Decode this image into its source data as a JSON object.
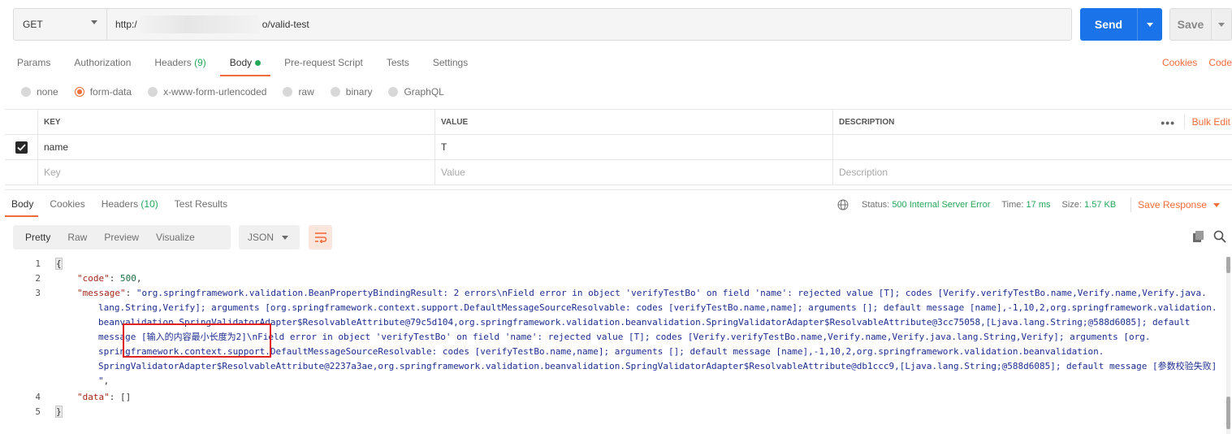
{
  "request": {
    "method": "GET",
    "url_prefix": "http:/",
    "url_suffix": "o/valid-test",
    "send_label": "Send",
    "save_label": "Save"
  },
  "request_tabs": [
    {
      "label": "Params"
    },
    {
      "label": "Authorization"
    },
    {
      "label": "Headers",
      "count": "(9)"
    },
    {
      "label": "Body",
      "active": true
    },
    {
      "label": "Pre-request Script"
    },
    {
      "label": "Tests"
    },
    {
      "label": "Settings"
    }
  ],
  "right_links": {
    "cookies": "Cookies",
    "code": "Code"
  },
  "body_types": [
    {
      "label": "none"
    },
    {
      "label": "form-data",
      "selected": true
    },
    {
      "label": "x-www-form-urlencoded"
    },
    {
      "label": "raw"
    },
    {
      "label": "binary"
    },
    {
      "label": "GraphQL"
    }
  ],
  "params_table": {
    "headers": {
      "key": "KEY",
      "value": "VALUE",
      "description": "DESCRIPTION"
    },
    "more_label": "•••",
    "bulk_edit": "Bulk Edit",
    "rows": [
      {
        "checked": true,
        "key": "name",
        "value": "T",
        "description": ""
      }
    ],
    "placeholders": {
      "key": "Key",
      "value": "Value",
      "description": "Description"
    }
  },
  "response_tabs": [
    {
      "label": "Body",
      "active": true
    },
    {
      "label": "Cookies"
    },
    {
      "label": "Headers",
      "count": "(10)"
    },
    {
      "label": "Test Results"
    }
  ],
  "status": {
    "status_label": "Status:",
    "status_value": "500 Internal Server Error",
    "time_label": "Time:",
    "time_value": "17 ms",
    "size_label": "Size:",
    "size_value": "1.57 KB",
    "save_response": "Save Response"
  },
  "view_modes": [
    "Pretty",
    "Raw",
    "Preview",
    "Visualize"
  ],
  "format": "JSON",
  "code_lines": [
    {
      "n": "1",
      "text": "{"
    },
    {
      "n": "2",
      "key": "\"code\"",
      "sep": ": ",
      "val": "500",
      "end": ","
    },
    {
      "n": "3",
      "key": "\"message\"",
      "sep": ": ",
      "val": "\"org.springframework.validation.BeanPropertyBindingResult: 2 errors\\nField error in object 'verifyTestBo' on field 'name': rejected value [T]; codes [Verify.verifyTestBo.name,Verify.name,Verify.java."
    },
    {
      "n": "",
      "cont": "lang.String,Verify]; arguments [org.springframework.context.support.DefaultMessageSourceResolvable: codes [verifyTestBo.name,name]; arguments []; default message [name],-1,10,2,org.springframework.validation."
    },
    {
      "n": "",
      "cont": "beanvalidation.SpringValidatorAdapter$ResolvableAttribute@79c5d104,org.springframework.validation.beanvalidation.SpringValidatorAdapter$ResolvableAttribute@3cc75058,[Ljava.lang.String;@588d6085]; default"
    },
    {
      "n": "",
      "cont": "message [输入的内容最小长度为2]\\nField error in object 'verifyTestBo' on field 'name': rejected value [T]; codes [Verify.verifyTestBo.name,Verify.name,Verify.java.lang.String,Verify]; arguments [org."
    },
    {
      "n": "",
      "cont": "springframework.context.support.DefaultMessageSourceResolvable: codes [verifyTestBo.name,name]; arguments []; default message [name],-1,10,2,org.springframework.validation.beanvalidation."
    },
    {
      "n": "",
      "cont": "SpringValidatorAdapter$ResolvableAttribute@2237a3ae,org.springframework.validation.beanvalidation.SpringValidatorAdapter$ResolvableAttribute@db1ccc9,[Ljava.lang.String;@588d6085]; default message [参数校验失败]"
    },
    {
      "n": "",
      "cont": "\"",
      "end": ","
    },
    {
      "n": "4",
      "key": "\"data\"",
      "sep": ": ",
      "val": "[]"
    },
    {
      "n": "5",
      "text": "}"
    }
  ],
  "colors": {
    "accent": "#f26b3a",
    "send": "#1a73e8",
    "success_green": "#26a65b",
    "annotation_red": "#e0231e"
  }
}
